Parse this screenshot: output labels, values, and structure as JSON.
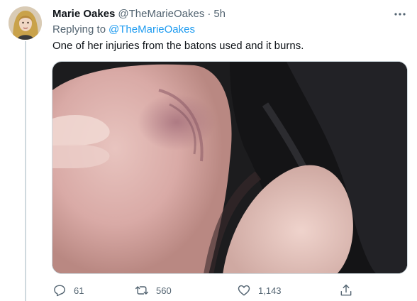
{
  "tweet": {
    "author_name": "Marie Oakes",
    "author_handle": "@TheMarieOakes",
    "separator": "·",
    "time": "5h",
    "replying_prefix": "Replying to",
    "replying_to": "@TheMarieOakes",
    "text": "One of her injuries from the batons used and it burns."
  },
  "actions": {
    "reply_count": "61",
    "retweet_count": "560",
    "like_count": "1,143"
  },
  "colors": {
    "link": "#1d9bf0",
    "secondary": "#536471",
    "text": "#0f1419",
    "border": "#cfd9de"
  },
  "icons": [
    "more-icon",
    "reply-icon",
    "retweet-icon",
    "like-icon",
    "share-icon"
  ]
}
